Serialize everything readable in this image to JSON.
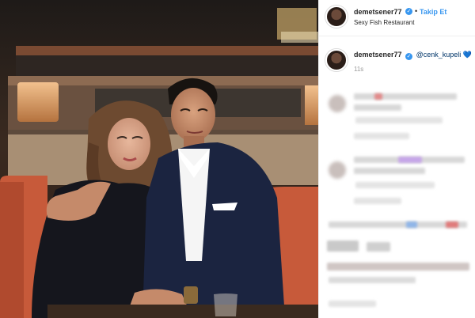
{
  "post": {
    "photo_alt": "",
    "author": {
      "username": "demetsener77",
      "verified_icon": "verified-badge-icon",
      "separator": "•",
      "follow_label": "Takip Et",
      "location": "Sexy Fish Restaurant"
    },
    "caption": {
      "username": "demetsener77",
      "mention": "@cenk_kupeli",
      "emoji_icon": "blue-heart-icon",
      "emoji": "💙",
      "time": "11s"
    }
  },
  "colors": {
    "accent": "#3897f0",
    "text": "#262626",
    "muted": "#999999",
    "border": "#efefef"
  }
}
